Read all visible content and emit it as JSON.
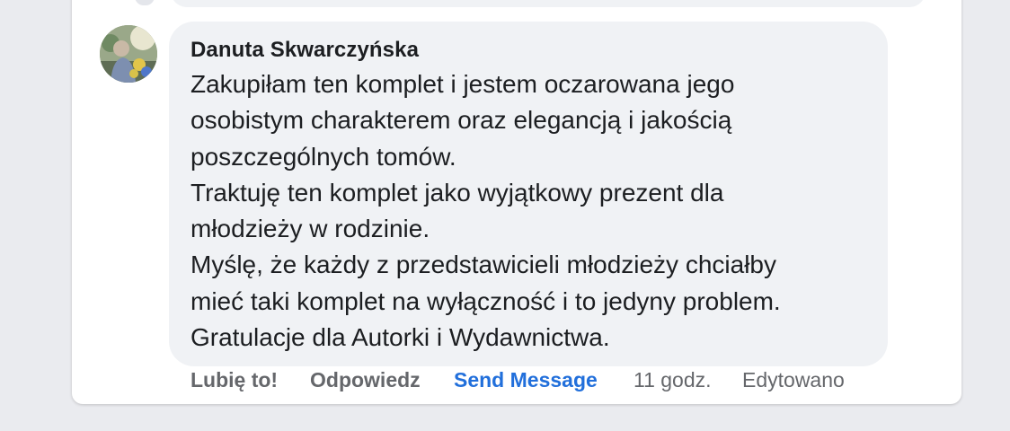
{
  "comment": {
    "author": "Danuta Skwarczyńska",
    "lines": [
      "Zakupiłam ten komplet i jestem oczarowana jego",
      "osobistym charakterem oraz elegancją i jakością",
      "poszczególnych tomów.",
      "Traktuję ten komplet jako wyjątkowy prezent dla",
      "młodzieży w rodzinie.",
      "Myślę, że każdy z przedstawicieli młodzieży chciałby",
      "mieć taki komplet na wyłączność i to jedyny problem.",
      "Gratulacje dla Autorki i Wydawnictwa."
    ]
  },
  "actions": {
    "like": "Lubię to!",
    "reply": "Odpowiedz",
    "send_message": "Send Message",
    "time": "11 godz.",
    "edited": "Edytowano"
  },
  "colors": {
    "page_background": "#eaebef",
    "bubble": "#f0f2f5",
    "text": "#1c1e21",
    "secondary_text": "#65676b",
    "link_blue": "#216fdb"
  }
}
